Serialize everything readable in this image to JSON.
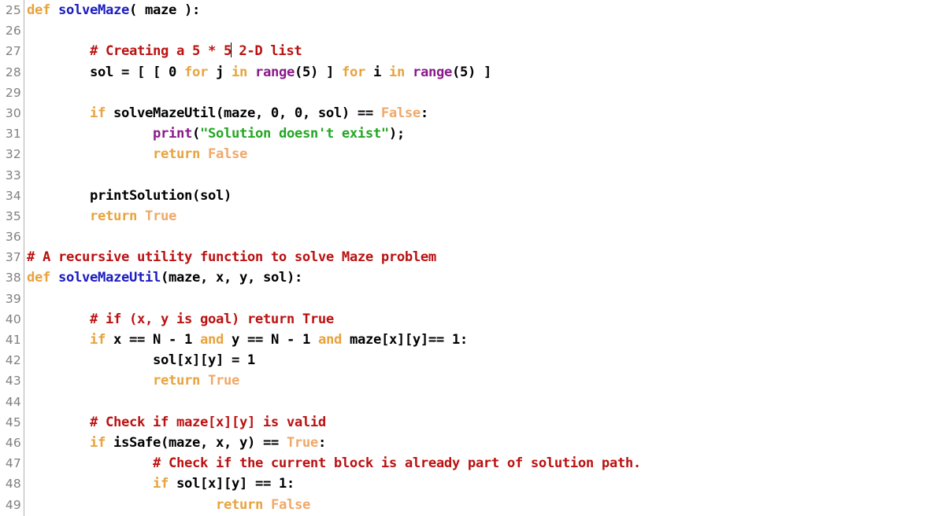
{
  "editor": {
    "name": "python-code-view",
    "language": "Python",
    "font_weight": "bold",
    "first_line_number": 25,
    "last_line_number": 49,
    "caret": {
      "line": 27,
      "after_text": "# Creating a 5 * 5"
    }
  },
  "colors": {
    "background": "#ffffff",
    "gutter_text": "#808080",
    "gutter_border": "#b0b0b0",
    "plain": "#000000",
    "keyword": "#e8a33d",
    "boolean": "#f0a868",
    "comment": "#bb1111",
    "string": "#23a723",
    "builtin": "#8a1a8a",
    "def_name": "#1b1bc0"
  },
  "gutter": {
    "numbers": [
      "25",
      "26",
      "27",
      "28",
      "29",
      "30",
      "31",
      "32",
      "33",
      "34",
      "35",
      "36",
      "37",
      "38",
      "39",
      "40",
      "41",
      "42",
      "43",
      "44",
      "45",
      "46",
      "47",
      "48",
      "49"
    ]
  },
  "lines": [
    {
      "number": "25",
      "text": "def solveMaze( maze ):",
      "tokens": [
        {
          "t": "def",
          "c": "keyword"
        },
        {
          "t": " ",
          "c": "plain"
        },
        {
          "t": "solveMaze",
          "c": "defname"
        },
        {
          "t": "( maze ):",
          "c": "plain"
        }
      ]
    },
    {
      "number": "26",
      "text": "",
      "tokens": []
    },
    {
      "number": "27",
      "text": "        # Creating a 5 * 5 2-D list",
      "tokens": [
        {
          "t": "        ",
          "c": "plain"
        },
        {
          "t": "# Creating a 5 * 5",
          "c": "comment"
        },
        {
          "t": "CARET",
          "c": "caret"
        },
        {
          "t": " 2-D list",
          "c": "comment"
        }
      ]
    },
    {
      "number": "28",
      "text": "        sol = [ [ 0 for j in range(5) ] for i in range(5) ]",
      "tokens": [
        {
          "t": "        sol = [ [ 0 ",
          "c": "plain"
        },
        {
          "t": "for",
          "c": "keyword"
        },
        {
          "t": " j ",
          "c": "plain"
        },
        {
          "t": "in",
          "c": "keyword"
        },
        {
          "t": " ",
          "c": "plain"
        },
        {
          "t": "range",
          "c": "builtin"
        },
        {
          "t": "(5) ] ",
          "c": "plain"
        },
        {
          "t": "for",
          "c": "keyword"
        },
        {
          "t": " i ",
          "c": "plain"
        },
        {
          "t": "in",
          "c": "keyword"
        },
        {
          "t": " ",
          "c": "plain"
        },
        {
          "t": "range",
          "c": "builtin"
        },
        {
          "t": "(5) ]",
          "c": "plain"
        }
      ]
    },
    {
      "number": "29",
      "text": "",
      "tokens": []
    },
    {
      "number": "30",
      "text": "        if solveMazeUtil(maze, 0, 0, sol) == False:",
      "tokens": [
        {
          "t": "        ",
          "c": "plain"
        },
        {
          "t": "if",
          "c": "keyword"
        },
        {
          "t": " solveMazeUtil(maze, 0, 0, sol) == ",
          "c": "plain"
        },
        {
          "t": "False",
          "c": "boolean"
        },
        {
          "t": ":",
          "c": "plain"
        }
      ]
    },
    {
      "number": "31",
      "text": "                print(\"Solution doesn't exist\");",
      "tokens": [
        {
          "t": "                ",
          "c": "plain"
        },
        {
          "t": "print",
          "c": "builtin"
        },
        {
          "t": "(",
          "c": "plain"
        },
        {
          "t": "\"Solution doesn't exist\"",
          "c": "string"
        },
        {
          "t": ");",
          "c": "plain"
        }
      ]
    },
    {
      "number": "32",
      "text": "                return False",
      "tokens": [
        {
          "t": "                ",
          "c": "plain"
        },
        {
          "t": "return",
          "c": "keyword"
        },
        {
          "t": " ",
          "c": "plain"
        },
        {
          "t": "False",
          "c": "boolean"
        }
      ]
    },
    {
      "number": "33",
      "text": "",
      "tokens": []
    },
    {
      "number": "34",
      "text": "        printSolution(sol)",
      "tokens": [
        {
          "t": "        printSolution(sol)",
          "c": "plain"
        }
      ]
    },
    {
      "number": "35",
      "text": "        return True",
      "tokens": [
        {
          "t": "        ",
          "c": "plain"
        },
        {
          "t": "return",
          "c": "keyword"
        },
        {
          "t": " ",
          "c": "plain"
        },
        {
          "t": "True",
          "c": "boolean"
        }
      ]
    },
    {
      "number": "36",
      "text": "",
      "tokens": []
    },
    {
      "number": "37",
      "text": "# A recursive utility function to solve Maze problem",
      "tokens": [
        {
          "t": "# A recursive utility function to solve Maze problem",
          "c": "comment"
        }
      ]
    },
    {
      "number": "38",
      "text": "def solveMazeUtil(maze, x, y, sol):",
      "tokens": [
        {
          "t": "def",
          "c": "keyword"
        },
        {
          "t": " ",
          "c": "plain"
        },
        {
          "t": "solveMazeUtil",
          "c": "defname"
        },
        {
          "t": "(maze, x, y, sol):",
          "c": "plain"
        }
      ]
    },
    {
      "number": "39",
      "text": "",
      "tokens": []
    },
    {
      "number": "40",
      "text": "        # if (x, y is goal) return True",
      "tokens": [
        {
          "t": "        ",
          "c": "plain"
        },
        {
          "t": "# if (x, y is goal) return True",
          "c": "comment"
        }
      ]
    },
    {
      "number": "41",
      "text": "        if x == N - 1 and y == N - 1 and maze[x][y]== 1:",
      "tokens": [
        {
          "t": "        ",
          "c": "plain"
        },
        {
          "t": "if",
          "c": "keyword"
        },
        {
          "t": " x == N - 1 ",
          "c": "plain"
        },
        {
          "t": "and",
          "c": "keyword"
        },
        {
          "t": " y == N - 1 ",
          "c": "plain"
        },
        {
          "t": "and",
          "c": "keyword"
        },
        {
          "t": " maze[x][y]== 1:",
          "c": "plain"
        }
      ]
    },
    {
      "number": "42",
      "text": "                sol[x][y] = 1",
      "tokens": [
        {
          "t": "                sol[x][y] = 1",
          "c": "plain"
        }
      ]
    },
    {
      "number": "43",
      "text": "                return True",
      "tokens": [
        {
          "t": "                ",
          "c": "plain"
        },
        {
          "t": "return",
          "c": "keyword"
        },
        {
          "t": " ",
          "c": "plain"
        },
        {
          "t": "True",
          "c": "boolean"
        }
      ]
    },
    {
      "number": "44",
      "text": "",
      "tokens": []
    },
    {
      "number": "45",
      "text": "        # Check if maze[x][y] is valid",
      "tokens": [
        {
          "t": "        ",
          "c": "plain"
        },
        {
          "t": "# Check if maze[x][y] is valid",
          "c": "comment"
        }
      ]
    },
    {
      "number": "46",
      "text": "        if isSafe(maze, x, y) == True:",
      "tokens": [
        {
          "t": "        ",
          "c": "plain"
        },
        {
          "t": "if",
          "c": "keyword"
        },
        {
          "t": " isSafe(maze, x, y) == ",
          "c": "plain"
        },
        {
          "t": "True",
          "c": "boolean"
        },
        {
          "t": ":",
          "c": "plain"
        }
      ]
    },
    {
      "number": "47",
      "text": "                # Check if the current block is already part of solution path.",
      "tokens": [
        {
          "t": "                ",
          "c": "plain"
        },
        {
          "t": "# Check if the current block is already part of solution path.",
          "c": "comment"
        }
      ]
    },
    {
      "number": "48",
      "text": "                if sol[x][y] == 1:",
      "tokens": [
        {
          "t": "                ",
          "c": "plain"
        },
        {
          "t": "if",
          "c": "keyword"
        },
        {
          "t": " sol[x][y] == 1:",
          "c": "plain"
        }
      ]
    },
    {
      "number": "49",
      "text": "                        return False",
      "tokens": [
        {
          "t": "                        ",
          "c": "plain"
        },
        {
          "t": "return",
          "c": "keyword"
        },
        {
          "t": " ",
          "c": "plain"
        },
        {
          "t": "False",
          "c": "boolean"
        }
      ]
    }
  ]
}
